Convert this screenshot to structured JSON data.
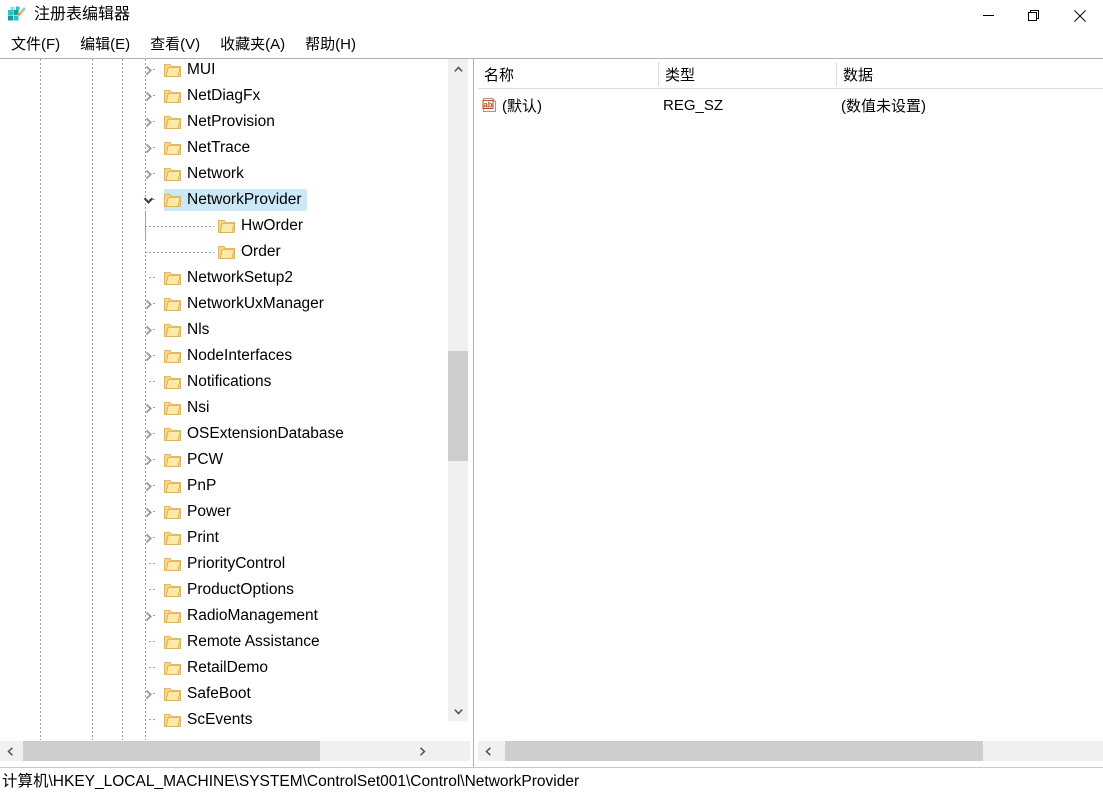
{
  "window": {
    "title": "注册表编辑器",
    "icon": "regedit-icon",
    "minimize_label": "—",
    "restore_label": "❐",
    "close_label": "✕"
  },
  "menu": {
    "items": [
      {
        "label": "文件(F)",
        "name": "menu-file"
      },
      {
        "label": "编辑(E)",
        "name": "menu-edit"
      },
      {
        "label": "查看(V)",
        "name": "menu-view"
      },
      {
        "label": "收藏夹(A)",
        "name": "menu-favorites"
      },
      {
        "label": "帮助(H)",
        "name": "menu-help"
      }
    ]
  },
  "tree": {
    "selected": "NetworkProvider",
    "nodes": [
      {
        "label": "MUI",
        "depth": 0,
        "expandable": true,
        "expanded": false,
        "selected": false,
        "partial_top": true
      },
      {
        "label": "NetDiagFx",
        "depth": 0,
        "expandable": true,
        "expanded": false,
        "selected": false
      },
      {
        "label": "NetProvision",
        "depth": 0,
        "expandable": true,
        "expanded": false,
        "selected": false
      },
      {
        "label": "NetTrace",
        "depth": 0,
        "expandable": true,
        "expanded": false,
        "selected": false
      },
      {
        "label": "Network",
        "depth": 0,
        "expandable": true,
        "expanded": false,
        "selected": false
      },
      {
        "label": "NetworkProvider",
        "depth": 0,
        "expandable": true,
        "expanded": true,
        "selected": true
      },
      {
        "label": "HwOrder",
        "depth": 1,
        "expandable": false,
        "expanded": false,
        "selected": false
      },
      {
        "label": "Order",
        "depth": 1,
        "expandable": false,
        "expanded": false,
        "selected": false,
        "last_child": true
      },
      {
        "label": "NetworkSetup2",
        "depth": 0,
        "expandable": false,
        "expanded": false,
        "selected": false
      },
      {
        "label": "NetworkUxManager",
        "depth": 0,
        "expandable": true,
        "expanded": false,
        "selected": false
      },
      {
        "label": "Nls",
        "depth": 0,
        "expandable": true,
        "expanded": false,
        "selected": false
      },
      {
        "label": "NodeInterfaces",
        "depth": 0,
        "expandable": true,
        "expanded": false,
        "selected": false
      },
      {
        "label": "Notifications",
        "depth": 0,
        "expandable": false,
        "expanded": false,
        "selected": false
      },
      {
        "label": "Nsi",
        "depth": 0,
        "expandable": true,
        "expanded": false,
        "selected": false
      },
      {
        "label": "OSExtensionDatabase",
        "depth": 0,
        "expandable": true,
        "expanded": false,
        "selected": false
      },
      {
        "label": "PCW",
        "depth": 0,
        "expandable": true,
        "expanded": false,
        "selected": false
      },
      {
        "label": "PnP",
        "depth": 0,
        "expandable": true,
        "expanded": false,
        "selected": false
      },
      {
        "label": "Power",
        "depth": 0,
        "expandable": true,
        "expanded": false,
        "selected": false
      },
      {
        "label": "Print",
        "depth": 0,
        "expandable": true,
        "expanded": false,
        "selected": false
      },
      {
        "label": "PriorityControl",
        "depth": 0,
        "expandable": false,
        "expanded": false,
        "selected": false
      },
      {
        "label": "ProductOptions",
        "depth": 0,
        "expandable": false,
        "expanded": false,
        "selected": false
      },
      {
        "label": "RadioManagement",
        "depth": 0,
        "expandable": true,
        "expanded": false,
        "selected": false
      },
      {
        "label": "Remote Assistance",
        "depth": 0,
        "expandable": false,
        "expanded": false,
        "selected": false
      },
      {
        "label": "RetailDemo",
        "depth": 0,
        "expandable": false,
        "expanded": false,
        "selected": false
      },
      {
        "label": "SafeBoot",
        "depth": 0,
        "expandable": true,
        "expanded": false,
        "selected": false
      },
      {
        "label": "ScEvents",
        "depth": 0,
        "expandable": false,
        "expanded": false,
        "selected": false
      }
    ]
  },
  "listview": {
    "columns": [
      {
        "label": "名称",
        "name": "column-name"
      },
      {
        "label": "类型",
        "name": "column-type"
      },
      {
        "label": "数据",
        "name": "column-data"
      }
    ],
    "rows": [
      {
        "icon": "string-value-icon",
        "name": "(默认)",
        "type": "REG_SZ",
        "data": "(数值未设置)"
      }
    ]
  },
  "status": {
    "path": "计算机\\HKEY_LOCAL_MACHINE\\SYSTEM\\ControlSet001\\Control\\NetworkProvider"
  },
  "colors": {
    "selection": "#cce8f7",
    "folder": "#ffd96e",
    "scrollbar_thumb": "#cdcdcd",
    "scrollbar_track": "#f0f0f0",
    "border": "#b0b0b0"
  }
}
